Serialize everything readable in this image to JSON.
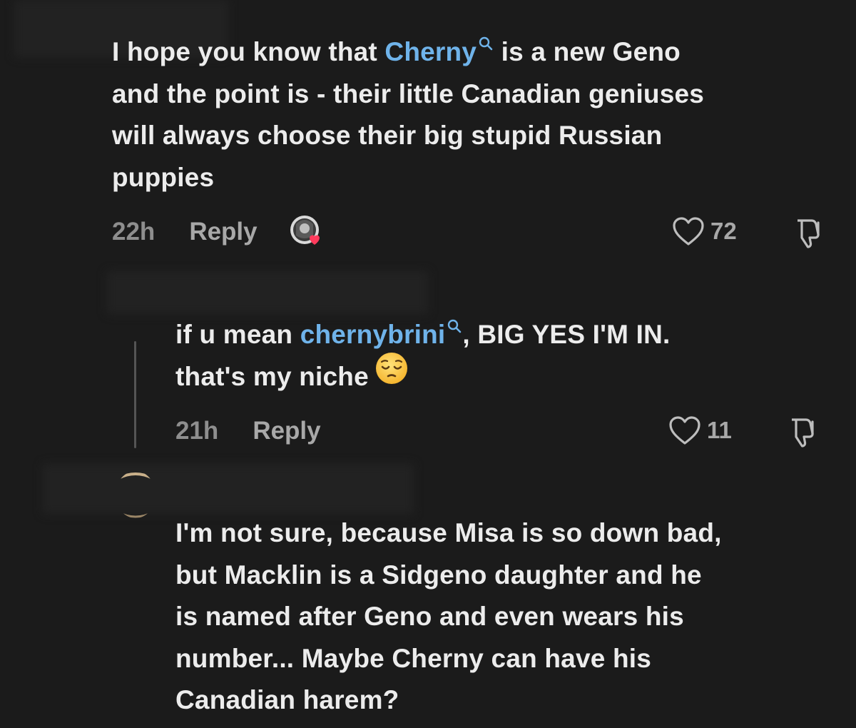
{
  "comments": [
    {
      "text_lines": [
        {
          "before": "I hope you know that ",
          "mention": "Cherny",
          "after": " is a new Geno"
        },
        {
          "text": "and the point is - their little Canadian geniuses"
        },
        {
          "text": "will always choose their big stupid Russian"
        },
        {
          "text": "puppies"
        }
      ],
      "time": "22h",
      "reply_label": "Reply",
      "likes": "72",
      "icons": {
        "like": "heart-outline-icon",
        "dislike": "thumbs-down-icon",
        "liked_by_creator": "creator-avatar-heart"
      }
    },
    {
      "text_lines": [
        {
          "before": "if u mean ",
          "mention": "chernybrini",
          "after": ", BIG YES I'M IN."
        },
        {
          "text": "that's my niche"
        }
      ],
      "emoji": "pensive-face",
      "time": "21h",
      "reply_label": "Reply",
      "likes": "11",
      "icons": {
        "like": "heart-outline-icon",
        "dislike": "thumbs-down-icon"
      }
    },
    {
      "text_lines": [
        {
          "text": "I'm not sure, because Misa is so down bad,"
        },
        {
          "text": "but Macklin is a Sidgeno daughter and he"
        },
        {
          "text": "is named after Geno and even wears his"
        },
        {
          "text": "number... Maybe Cherny can have his"
        },
        {
          "text": "Canadian harem?"
        }
      ]
    }
  ],
  "colors": {
    "background": "#1b1b1b",
    "text": "#ececec",
    "mention": "#6fb3ea",
    "meta": "#a8a8a8",
    "heart_badge": "#ff3b5c"
  }
}
